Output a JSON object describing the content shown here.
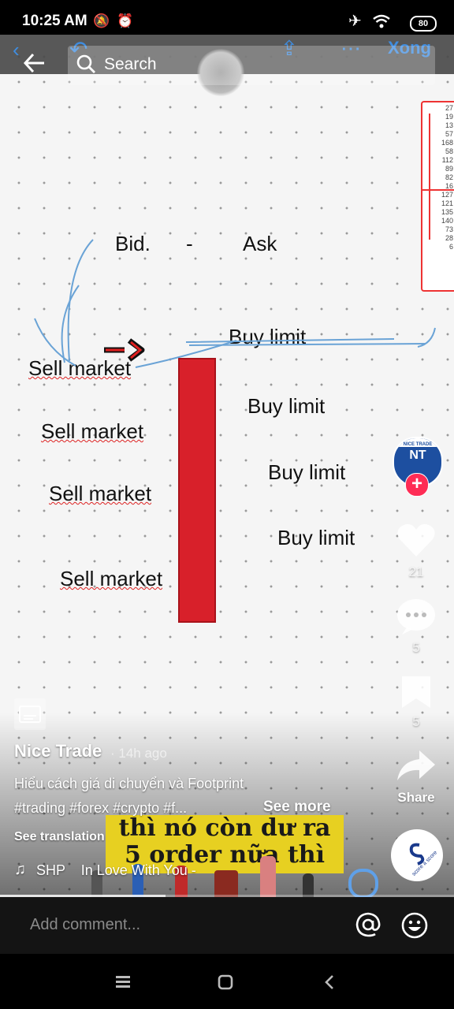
{
  "status_bar": {
    "time": "10:25 AM",
    "battery": "80"
  },
  "header": {
    "ghost_done": "Xong",
    "search_placeholder": "Search"
  },
  "drawing": {
    "bid": "Bid.",
    "dash": "-",
    "ask": "Ask",
    "sell_labels": [
      "Sell market",
      "Sell market",
      "Sell market",
      "Sell market"
    ],
    "buy_labels": [
      "Buy limit",
      "Buy limit",
      "Buy limit",
      "Buy limit"
    ],
    "side_chart_numbers": [
      "27",
      "19",
      "13",
      "57",
      "168",
      "58",
      "112",
      "89",
      "82",
      "16",
      "127",
      "121",
      "135",
      "140",
      "73",
      "28",
      "6"
    ],
    "avatar_brand": "NICE TRADE",
    "avatar_initials": "NT"
  },
  "caption_overlay": {
    "line1": "thì nó còn dư ra",
    "line2": "5 order nữa thì"
  },
  "rail": {
    "likes": "21",
    "comments": "5",
    "saves": "5",
    "share": "Share",
    "score_badge": "score a score"
  },
  "post": {
    "author": "Nice Trade",
    "time_ago": "· 14h ago",
    "description": "Hiểu cách giá di chuyển và Footprint",
    "hashtags": "#trading #forex #crypto #f...",
    "see_more": "See more",
    "see_translation": "See translation",
    "music": "SHP    In Love With You -"
  },
  "comment": {
    "placeholder": "Add comment..."
  },
  "colors": {
    "candle": "#d8202a",
    "caption_bg": "#e7d021",
    "follow_plus": "#fe2c55"
  }
}
